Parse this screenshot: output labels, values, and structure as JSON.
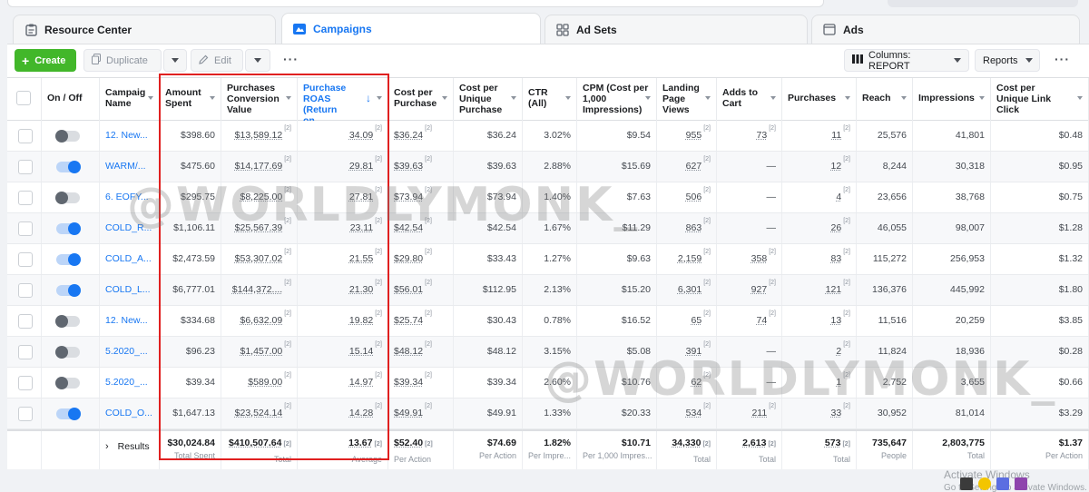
{
  "tabs": [
    {
      "label": "Resource Center",
      "icon": "clipboard-icon"
    },
    {
      "label": "Campaigns",
      "icon": "campaign-flag-icon"
    },
    {
      "label": "Ad Sets",
      "icon": "grid-icon"
    },
    {
      "label": "Ads",
      "icon": "ad-icon"
    }
  ],
  "toolbar": {
    "create_label": "Create",
    "duplicate_label": "Duplicate",
    "edit_label": "Edit",
    "columns_label": "Columns: REPORT",
    "reports_label": "Reports"
  },
  "columns": {
    "onoff": "On / Off",
    "name": "Campaig Name",
    "amount_spent": "Amount Spent",
    "conv_value": "Purchases Conversion Value",
    "roas": "Purchase ROAS (Return on…",
    "cost_per_purchase": "Cost per Purchase",
    "cost_per_unique_purchase": "Cost per Unique Purchase",
    "ctr": "CTR (All)",
    "cpm": "CPM (Cost per 1,000 Impressions)",
    "lpv": "Landing Page Views",
    "atc": "Adds to Cart",
    "purchases": "Purchases",
    "reach": "Reach",
    "impressions": "Impressions",
    "cpulc": "Cost per Unique Link Click"
  },
  "rows": [
    {
      "on": false,
      "name": "12. New...",
      "spent": "$398.60",
      "value": "$13,589.12",
      "roas": "34.09",
      "cpp": "$36.24",
      "cpup": "$36.24",
      "ctr": "3.02%",
      "cpm": "$9.54",
      "lpv": "955",
      "atc": "73",
      "purch": "11",
      "reach": "25,576",
      "impr": "41,801",
      "cpulc": "$0.48"
    },
    {
      "on": true,
      "name": "WARM/...",
      "spent": "$475.60",
      "value": "$14,177.69",
      "roas": "29.81",
      "cpp": "$39.63",
      "cpup": "$39.63",
      "ctr": "2.88%",
      "cpm": "$15.69",
      "lpv": "627",
      "atc": "—",
      "purch": "12",
      "reach": "8,244",
      "impr": "30,318",
      "cpulc": "$0.95"
    },
    {
      "on": false,
      "name": "6. EOFY...",
      "spent": "$295.75",
      "value": "$8,225.00",
      "roas": "27.81",
      "cpp": "$73.94",
      "cpup": "$73.94",
      "ctr": "1.40%",
      "cpm": "$7.63",
      "lpv": "506",
      "atc": "—",
      "purch": "4",
      "reach": "23,656",
      "impr": "38,768",
      "cpulc": "$0.75"
    },
    {
      "on": true,
      "name": "COLD_R...",
      "spent": "$1,106.11",
      "value": "$25,567.39",
      "roas": "23.11",
      "cpp": "$42.54",
      "cpup": "$42.54",
      "ctr": "1.67%",
      "cpm": "$11.29",
      "lpv": "863",
      "atc": "—",
      "purch": "26",
      "reach": "46,055",
      "impr": "98,007",
      "cpulc": "$1.28"
    },
    {
      "on": true,
      "name": "COLD_A...",
      "spent": "$2,473.59",
      "value": "$53,307.02",
      "roas": "21.55",
      "cpp": "$29.80",
      "cpup": "$33.43",
      "ctr": "1.27%",
      "cpm": "$9.63",
      "lpv": "2,159",
      "atc": "358",
      "purch": "83",
      "reach": "115,272",
      "impr": "256,953",
      "cpulc": "$1.32"
    },
    {
      "on": true,
      "name": "COLD_L...",
      "spent": "$6,777.01",
      "value": "$144,372....",
      "roas": "21.30",
      "cpp": "$56.01",
      "cpup": "$112.95",
      "ctr": "2.13%",
      "cpm": "$15.20",
      "lpv": "6,301",
      "atc": "927",
      "purch": "121",
      "reach": "136,376",
      "impr": "445,992",
      "cpulc": "$1.80"
    },
    {
      "on": false,
      "name": "12. New...",
      "spent": "$334.68",
      "value": "$6,632.09",
      "roas": "19.82",
      "cpp": "$25.74",
      "cpup": "$30.43",
      "ctr": "0.78%",
      "cpm": "$16.52",
      "lpv": "65",
      "atc": "74",
      "purch": "13",
      "reach": "11,516",
      "impr": "20,259",
      "cpulc": "$3.85"
    },
    {
      "on": false,
      "name": "5.2020_...",
      "spent": "$96.23",
      "value": "$1,457.00",
      "roas": "15.14",
      "cpp": "$48.12",
      "cpup": "$48.12",
      "ctr": "3.15%",
      "cpm": "$5.08",
      "lpv": "391",
      "atc": "—",
      "purch": "2",
      "reach": "11,824",
      "impr": "18,936",
      "cpulc": "$0.28"
    },
    {
      "on": false,
      "name": "5.2020_...",
      "spent": "$39.34",
      "value": "$589.00",
      "roas": "14.97",
      "cpp": "$39.34",
      "cpup": "$39.34",
      "ctr": "2.60%",
      "cpm": "$10.76",
      "lpv": "62",
      "atc": "—",
      "purch": "1",
      "reach": "2,752",
      "impr": "3,655",
      "cpulc": "$0.66"
    },
    {
      "on": true,
      "name": "COLD_O...",
      "spent": "$1,647.13",
      "value": "$23,524.14",
      "roas": "14.28",
      "cpp": "$49.91",
      "cpup": "$49.91",
      "ctr": "1.33%",
      "cpm": "$20.33",
      "lpv": "534",
      "atc": "211",
      "purch": "33",
      "reach": "30,952",
      "impr": "81,014",
      "cpulc": "$3.29"
    }
  ],
  "sup_mark": "[2]",
  "totals": {
    "label": "Results",
    "spent": {
      "value": "$30,024.84",
      "sub": "Total Spent"
    },
    "value": {
      "value": "$410,507.64",
      "sub": "Total"
    },
    "roas": {
      "value": "13.67",
      "sub": "Average"
    },
    "cpp": {
      "value": "$52.40",
      "sub": "Per Action"
    },
    "cpup": {
      "value": "$74.69",
      "sub": "Per Action"
    },
    "ctr": {
      "value": "1.82%",
      "sub": "Per Impre..."
    },
    "cpm": {
      "value": "$10.71",
      "sub": "Per 1,000 Impres..."
    },
    "lpv": {
      "value": "34,330",
      "sub": "Total"
    },
    "atc": {
      "value": "2,613",
      "sub": "Total"
    },
    "purch": {
      "value": "573",
      "sub": "Total"
    },
    "reach": {
      "value": "735,647",
      "sub": "People"
    },
    "impr": {
      "value": "2,803,775",
      "sub": "Total"
    },
    "cpulc": {
      "value": "$1.37",
      "sub": "Per Action"
    }
  },
  "watermark": "@WORLDLYMONK_",
  "os_overlay": {
    "line1": "Activate Windows",
    "line2": "Go to Settings to activate Windows."
  },
  "colors": {
    "accent": "#1877f2",
    "create": "#42b72a",
    "highlight_box": "#e02020"
  }
}
